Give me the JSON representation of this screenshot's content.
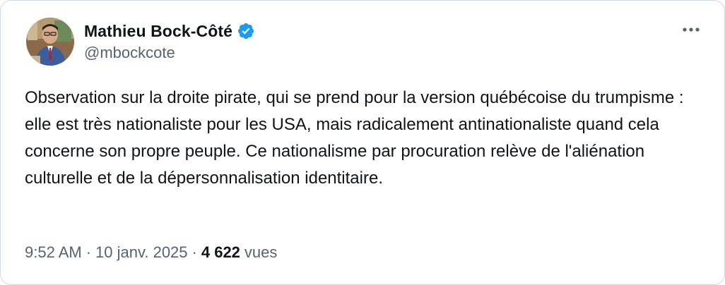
{
  "author": {
    "display_name": "Mathieu Bock-Côté",
    "handle": "@mbockcote",
    "verified": true,
    "verified_color": "#1d9bf0"
  },
  "post": {
    "text": "Observation sur la droite pirate, qui se prend pour la version québécoise du trumpisme : elle est très nationaliste pour les USA, mais radicalement antinationaliste quand cela concerne son propre peuple. Ce nationalisme par procuration relève de l'aliénation culturelle et de la dépersonnalisation identitaire."
  },
  "meta": {
    "time": "9:52 AM",
    "separator": "·",
    "date": "10 janv. 2025",
    "views_count": "4 622",
    "views_label": "vues"
  },
  "icons": {
    "more": "more-horizontal-icon",
    "verified": "verified-badge-icon"
  },
  "colors": {
    "text_primary": "#0f1419",
    "text_secondary": "#536471",
    "border": "#cfd9de"
  }
}
